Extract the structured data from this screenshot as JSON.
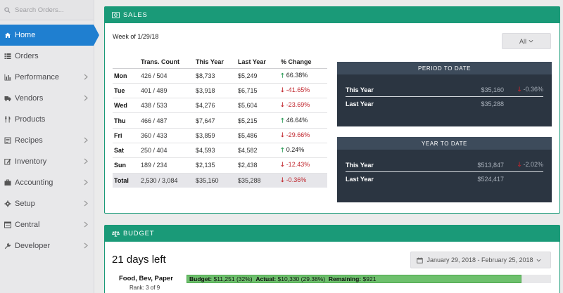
{
  "search": {
    "placeholder": "Search Orders..."
  },
  "sidebar": {
    "items": [
      {
        "label": "Home",
        "icon": "home-icon",
        "active": true
      },
      {
        "label": "Orders",
        "icon": "list-icon"
      },
      {
        "label": "Performance",
        "icon": "bar-chart-icon"
      },
      {
        "label": "Vendors",
        "icon": "truck-icon"
      },
      {
        "label": "Products",
        "icon": "utensils-icon"
      },
      {
        "label": "Recipes",
        "icon": "recipe-icon"
      },
      {
        "label": "Inventory",
        "icon": "edit-icon"
      },
      {
        "label": "Accounting",
        "icon": "briefcase-icon"
      },
      {
        "label": "Setup",
        "icon": "gear-icon"
      },
      {
        "label": "Central",
        "icon": "database-icon"
      },
      {
        "label": "Developer",
        "icon": "wrench-icon"
      }
    ]
  },
  "sales": {
    "title": "SALES",
    "week": "Week of 1/29/18",
    "filter_label": "All",
    "columns": [
      "Trans. Count",
      "This Year",
      "Last Year",
      "% Change"
    ],
    "rows": [
      {
        "day": "Mon",
        "trans": "426 / 504",
        "this_year": "$8,733",
        "last_year": "$5,249",
        "change": "66.38%",
        "dir": "up"
      },
      {
        "day": "Tue",
        "trans": "401 / 489",
        "this_year": "$3,918",
        "last_year": "$6,715",
        "change": "-41.65%",
        "dir": "down"
      },
      {
        "day": "Wed",
        "trans": "438 / 533",
        "this_year": "$4,276",
        "last_year": "$5,604",
        "change": "-23.69%",
        "dir": "down"
      },
      {
        "day": "Thu",
        "trans": "466 / 487",
        "this_year": "$7,647",
        "last_year": "$5,215",
        "change": "46.64%",
        "dir": "up"
      },
      {
        "day": "Fri",
        "trans": "360 / 433",
        "this_year": "$3,859",
        "last_year": "$5,486",
        "change": "-29.66%",
        "dir": "down"
      },
      {
        "day": "Sat",
        "trans": "250 / 404",
        "this_year": "$4,593",
        "last_year": "$4,582",
        "change": "0.24%",
        "dir": "up"
      },
      {
        "day": "Sun",
        "trans": "189 / 234",
        "this_year": "$2,135",
        "last_year": "$2,438",
        "change": "-12.43%",
        "dir": "down"
      },
      {
        "day": "Total",
        "trans": "2,530 / 3,084",
        "this_year": "$35,160",
        "last_year": "$35,288",
        "change": "-0.36%",
        "dir": "down"
      }
    ],
    "period_to_date": {
      "title": "PERIOD TO DATE",
      "this_year_label": "This Year",
      "this_year_value": "$35,160",
      "change": "-0.36%",
      "last_year_label": "Last Year",
      "last_year_value": "$35,288"
    },
    "year_to_date": {
      "title": "YEAR TO DATE",
      "this_year_label": "This Year",
      "this_year_value": "$513,847",
      "change": "-2.02%",
      "last_year_label": "Last Year",
      "last_year_value": "$524,417"
    }
  },
  "budget": {
    "title": "BUDGET",
    "days_left": "21 days left",
    "date_range": "January 29, 2018 - February 25, 2018",
    "category": {
      "name": "Food, Bev, Paper",
      "rank": "Rank: 3 of 9",
      "budget_label": "Budget:",
      "budget_value": "$11,251 (32%)",
      "actual_label": "Actual:",
      "actual_value": "$10,330 (29.38%)",
      "remaining_label": "Remaining:",
      "remaining_value": "$921",
      "fill_percent": 91.8
    }
  },
  "colors": {
    "accent": "#1a9a78",
    "active_nav": "#1f7fd0",
    "dark_card": "#2b3541",
    "up": "#2a9a55",
    "down": "#c0262d",
    "bar_fill": "#6ec06d"
  }
}
